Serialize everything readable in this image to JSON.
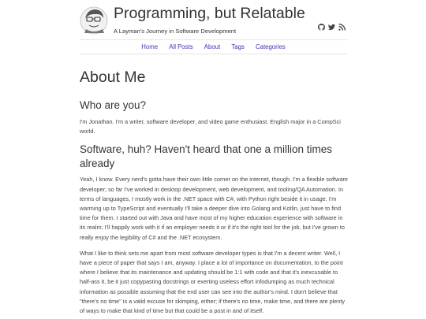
{
  "site": {
    "title": "Programming, but Relatable",
    "subtitle": "A Layman's Journey in Software Development",
    "social_icons": [
      "github-icon",
      "twitter-icon",
      "rss-icon"
    ]
  },
  "nav": {
    "items": [
      "Home",
      "All Posts",
      "About",
      "Tags",
      "Categories"
    ]
  },
  "page": {
    "title": "About Me",
    "sections": [
      {
        "heading": "Who are you?",
        "paragraphs": [
          "I'm Jonathan. I'm a writer, software developer, and video game enthusiast. English major in a CompSci world."
        ]
      },
      {
        "heading": "Software, huh? Haven't heard that one a million times already",
        "paragraphs": [
          "Yeah, I know. Every nerd's gotta have their own little corner on the internet, though. I'm a flexible software developer; so far I've worked in desktop development, web development, and tooling/QA Automation. In terms of languages, I mostly work in the .NET space with C#, with Python right beside it in usage. I'm warming up to TypeScript and eventually I'll take a deeper dive into Golang and Kotlin, just have to find time for them. I started out with Java and have most of my higher education experience with software in its realm; I'll happily work with it if an employer needs it or if it's the right tool for the job, but I've grown to really enjoy the legibility of C# and the .NET ecosystem.",
          "What I like to think sets me apart from most software developer types is that I'm a decent writer. Well, I have a piece of paper that says I am, anyway. I place a lot of importance on documentation, to the point where I believe that its maintenance and updating should be 1:1 with code and that it's inexcusable to half-ass it, be it just copypasting docstrings or exerting useless effort infodumping as much technical information as possible assuming that the end user can see into the author's mind. I don't believe that \"there's no time\" is a valid excuse for skimping, either; if there's no time, make time, and there are plenty of ways to make that kind of time but that could be a post in and of itself."
        ]
      }
    ]
  },
  "colors": {
    "link": "#4a2fb5",
    "text": "#333333",
    "divider": "#e6e6e6"
  }
}
